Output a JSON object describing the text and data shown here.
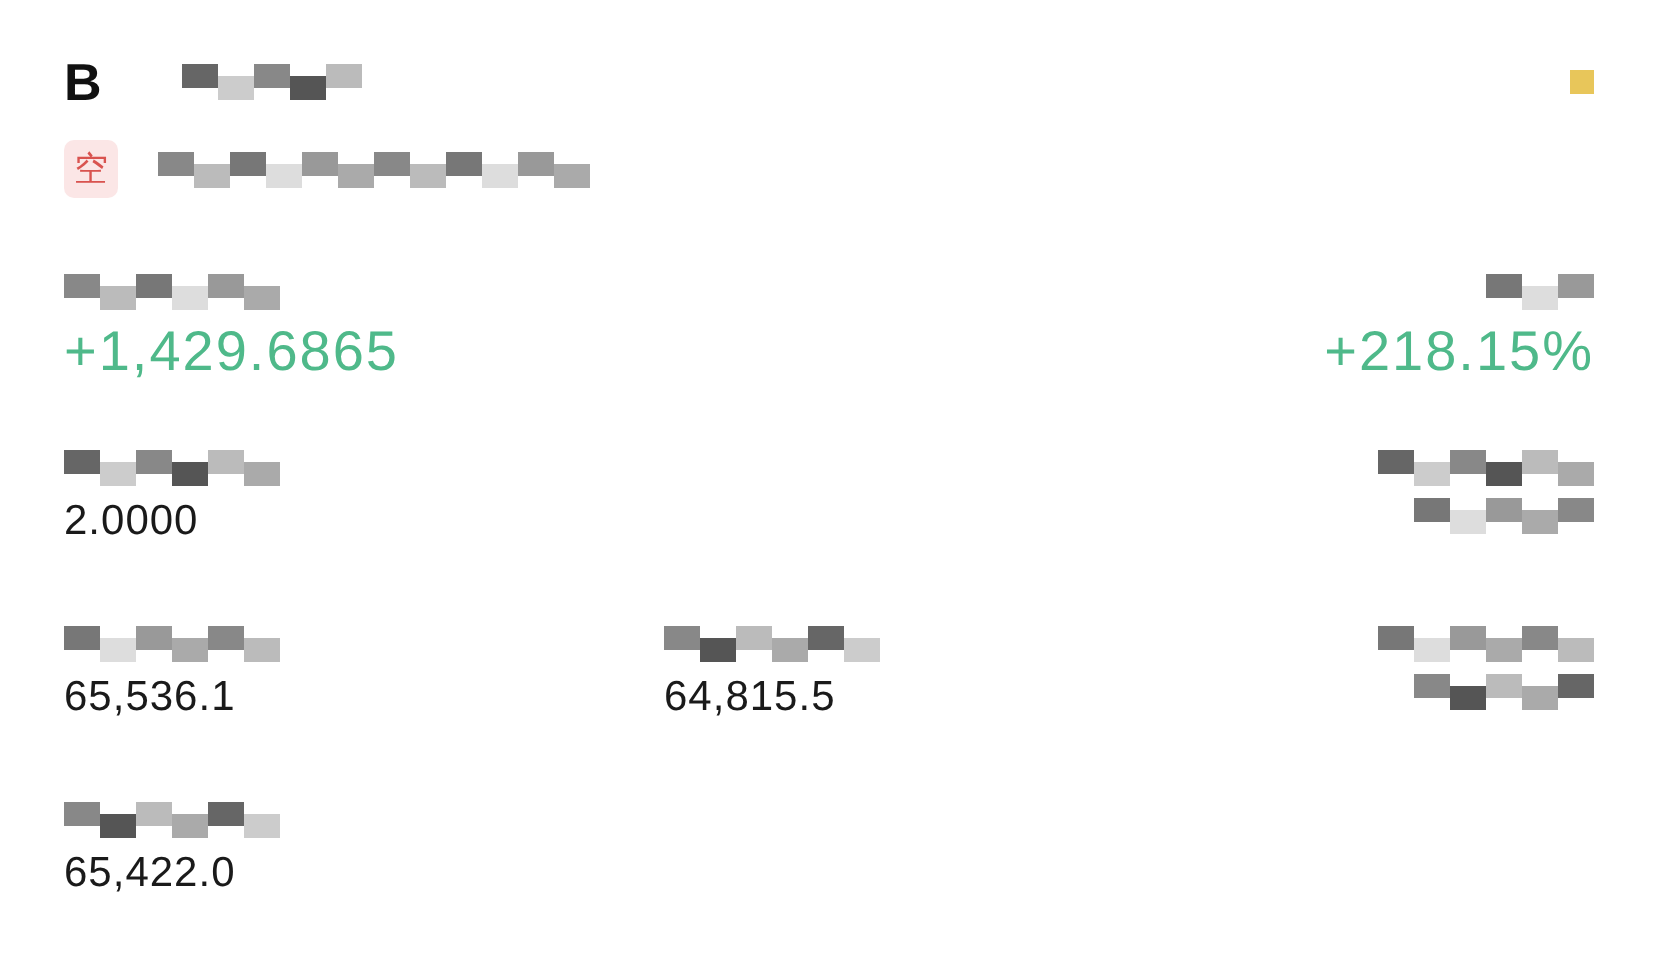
{
  "header": {
    "title": "B",
    "badge": "空"
  },
  "rows": [
    [
      {
        "kind": "gain",
        "value": "+1,429.6865"
      },
      {
        "kind": "empty"
      },
      {
        "kind": "gain",
        "value": "+218.15%"
      }
    ],
    [
      {
        "kind": "plain",
        "value": "2.0000"
      },
      {
        "kind": "empty"
      },
      {
        "kind": "redacted"
      }
    ],
    [
      {
        "kind": "plain",
        "value": "65,536.1"
      },
      {
        "kind": "plain",
        "value": "64,815.5"
      },
      {
        "kind": "redacted"
      }
    ],
    [
      {
        "kind": "plain",
        "value": "65,422.0"
      },
      {
        "kind": "empty"
      },
      {
        "kind": "empty"
      }
    ]
  ]
}
